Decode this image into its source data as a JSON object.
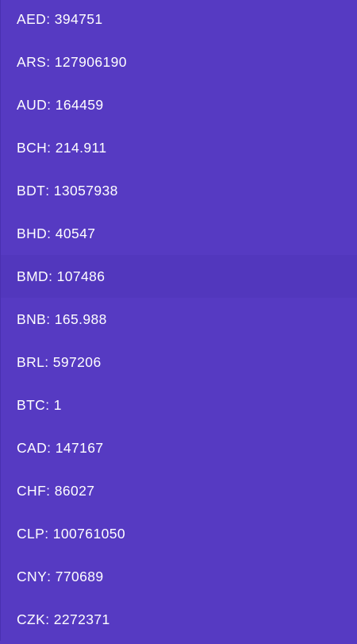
{
  "rates": [
    {
      "code": "AED",
      "value": "394751"
    },
    {
      "code": "ARS",
      "value": "127906190"
    },
    {
      "code": "AUD",
      "value": "164459"
    },
    {
      "code": "BCH",
      "value": "214.911"
    },
    {
      "code": "BDT",
      "value": "13057938"
    },
    {
      "code": "BHD",
      "value": "40547"
    },
    {
      "code": "BMD",
      "value": "107486"
    },
    {
      "code": "BNB",
      "value": "165.988"
    },
    {
      "code": "BRL",
      "value": "597206"
    },
    {
      "code": "BTC",
      "value": "1"
    },
    {
      "code": "CAD",
      "value": "147167"
    },
    {
      "code": "CHF",
      "value": "86027"
    },
    {
      "code": "CLP",
      "value": "100761050"
    },
    {
      "code": "CNY",
      "value": "770689"
    },
    {
      "code": "CZK",
      "value": "2272371"
    }
  ],
  "separator": ": ",
  "colors": {
    "background": "#563AC2",
    "pressed_row": "#5237BD",
    "text": "#FFFFFF"
  }
}
